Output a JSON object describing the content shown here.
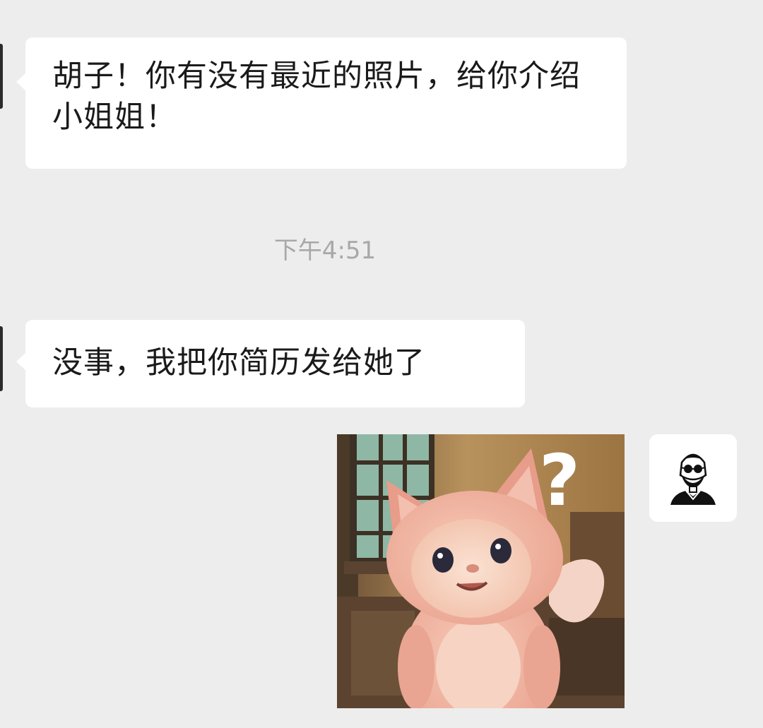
{
  "messages": [
    {
      "sender": "other",
      "text": "胡子！你有没有最近的照片，给你介绍小姐姐！"
    },
    {
      "sender": "other",
      "text": "没事，我把你简历发给她了"
    }
  ],
  "timestamp": "下午4:51",
  "sticker": {
    "overlay_text": "?"
  },
  "avatar": {
    "icon": "bearded-man-sunglasses-icon"
  },
  "colors": {
    "background": "#ededed",
    "bubble": "#ffffff",
    "text": "#1a1a1a",
    "timestamp": "#a8a8a8"
  }
}
